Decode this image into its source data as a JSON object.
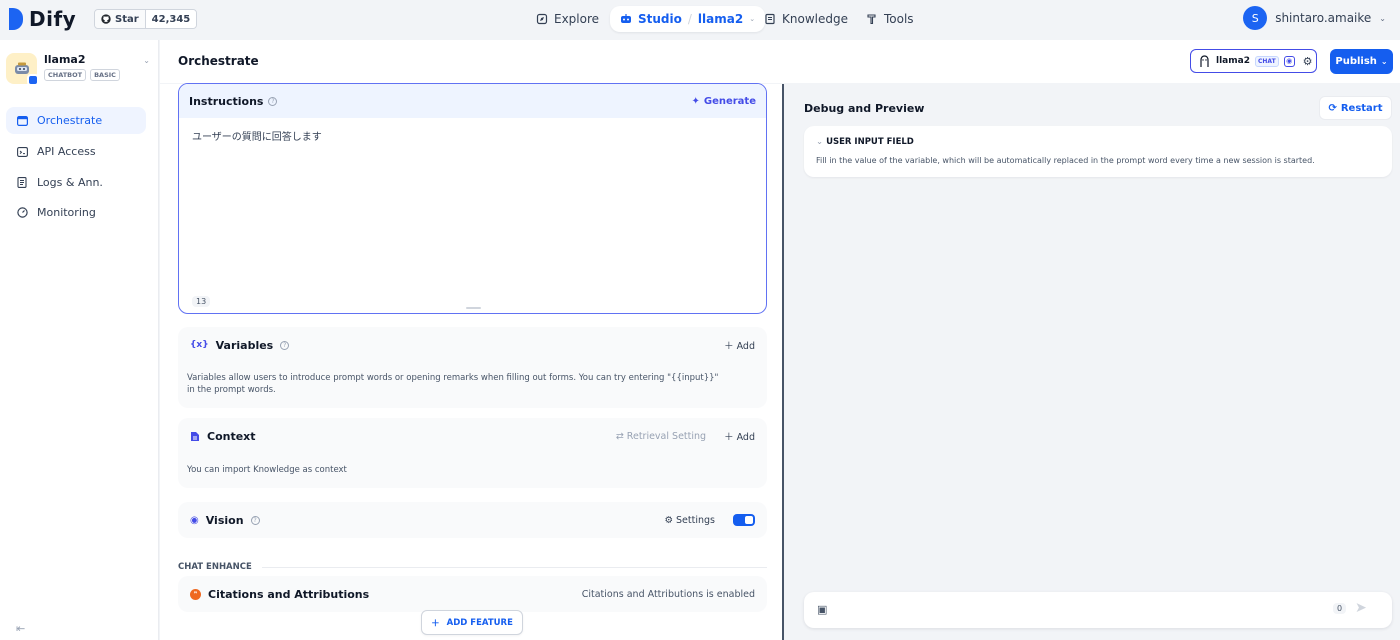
{
  "brand": {
    "name": "Dify"
  },
  "github": {
    "label": "Star",
    "count": "42,345"
  },
  "nav": {
    "explore": "Explore",
    "studio": "Studio",
    "app": "llama2",
    "knowledge": "Knowledge",
    "tools": "Tools"
  },
  "user": {
    "initial": "S",
    "name": "shintaro.amaike"
  },
  "app": {
    "name": "llama2",
    "tags": [
      "CHATBOT",
      "BASIC"
    ]
  },
  "sidebar": {
    "items": [
      {
        "label": "Orchestrate",
        "icon": "terminal-window-icon",
        "active": true
      },
      {
        "label": "API Access",
        "icon": "api-icon",
        "active": false
      },
      {
        "label": "Logs & Ann.",
        "icon": "document-list-icon",
        "active": false
      },
      {
        "label": "Monitoring",
        "icon": "dashboard-icon",
        "active": false
      }
    ]
  },
  "orchestrate": {
    "title": "Orchestrate",
    "model": {
      "name": "llama2",
      "mode": "CHAT"
    },
    "publish": "Publish",
    "instructions": {
      "label": "Instructions",
      "generate": "Generate",
      "text": "ユーザーの質問に回答します",
      "count": "13"
    },
    "variables": {
      "title": "Variables",
      "add": "Add",
      "desc": "Variables allow users to introduce prompt words or opening remarks when filling out forms. You can try entering \"{{input}}\" in the prompt words."
    },
    "context": {
      "title": "Context",
      "retrieval": "Retrieval Setting",
      "add": "Add",
      "desc": "You can import Knowledge as context"
    },
    "vision": {
      "title": "Vision",
      "settings": "Settings",
      "enabled": true
    },
    "chat_enhance": "CHAT ENHANCE",
    "citations": {
      "title": "Citations and Attributions",
      "status": "Citations and Attributions is enabled"
    },
    "add_feature": "ADD FEATURE"
  },
  "debug": {
    "title": "Debug and Preview",
    "restart": "Restart",
    "user_input": {
      "title": "USER INPUT FIELD",
      "desc": "Fill in the value of the variable, which will be automatically replaced in the prompt word every time a new session is started."
    },
    "char_count": "0"
  },
  "colors": {
    "primary": "#155eef",
    "accent": "#444ce7"
  }
}
